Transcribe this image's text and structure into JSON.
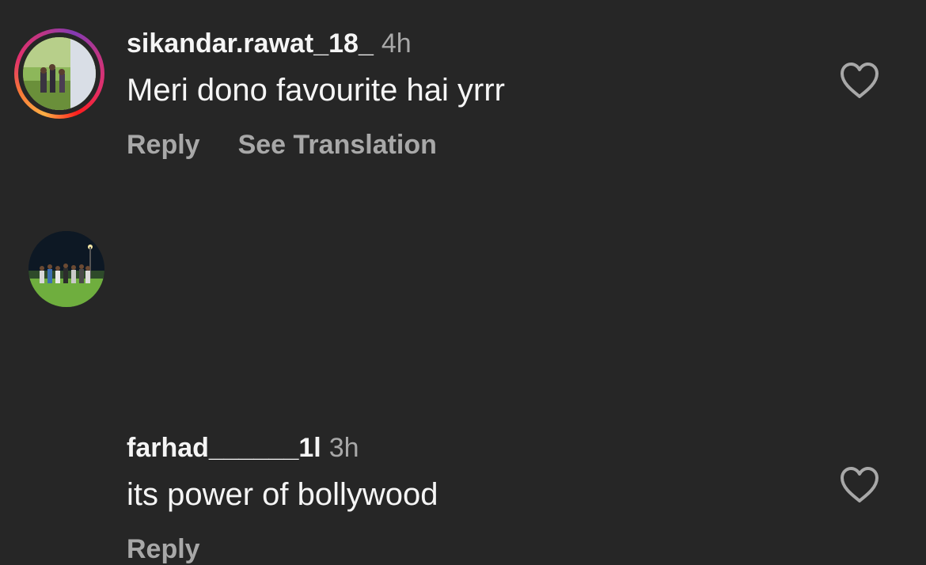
{
  "comments": [
    {
      "username": "sikandar.rawat_18_",
      "time": "4h",
      "text": "Meri dono favourite hai yrrr",
      "actions": {
        "reply": "Reply",
        "see_translation": "See Translation"
      },
      "has_story_ring": true,
      "like_icon": "heart-outline-icon"
    },
    {
      "username": "farhad______1l",
      "time": "3h",
      "text": "its power of bollywood",
      "actions": {
        "reply": "Reply"
      },
      "has_story_ring": false,
      "like_icon": "heart-outline-icon"
    }
  ],
  "colors": {
    "background": "#262626",
    "primary_text": "#f5f5f5",
    "secondary_text": "#a8a8a8"
  }
}
